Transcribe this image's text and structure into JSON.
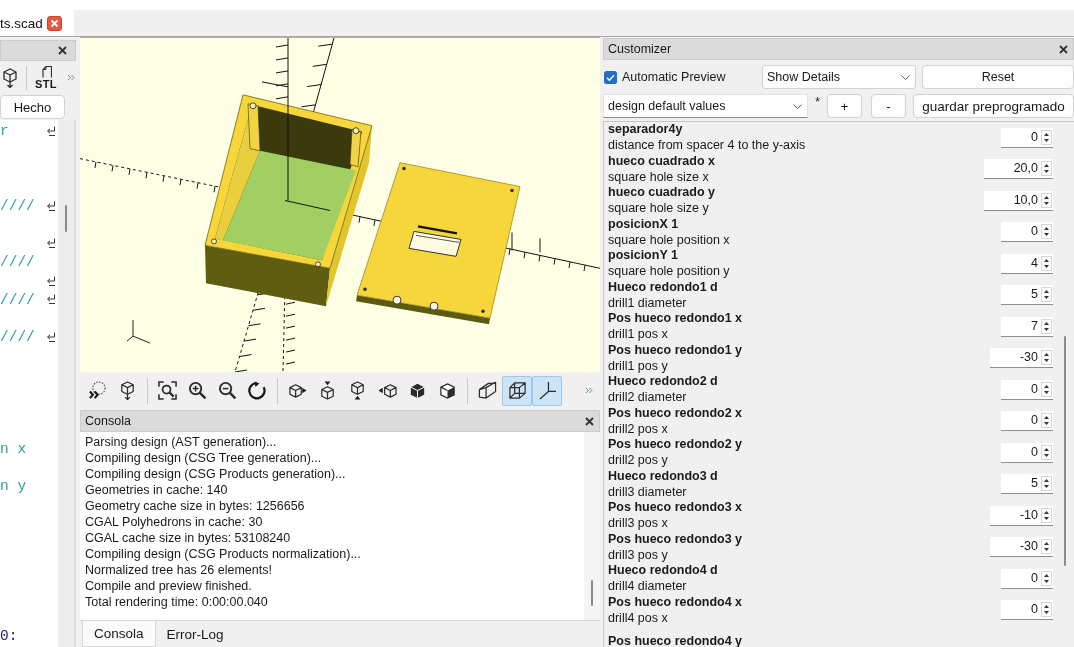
{
  "tab": {
    "label": "ts.scad"
  },
  "editor": {
    "export_label": "STL",
    "done_button": "Hecho",
    "lines": [
      {
        "kind": "comment",
        "text": "r",
        "wrapped": true
      },
      {
        "wrapped": false
      },
      {
        "wrapped": false
      },
      {
        "wrapped": false
      },
      {
        "kind": "comment",
        "text": "////",
        "wrapped": true
      },
      {
        "wrapped": false
      },
      {
        "wrapped": true
      },
      {
        "kind": "comment",
        "text": "////",
        "wrapped": false
      },
      {
        "wrapped": true
      },
      {
        "kind": "comment",
        "text": "////",
        "wrapped": true
      },
      {
        "wrapped": false
      },
      {
        "kind": "comment",
        "text": "////",
        "wrapped": true
      },
      {
        "wrapped": false
      },
      {
        "wrapped": false
      },
      {
        "wrapped": false
      },
      {
        "wrapped": false
      },
      {
        "wrapped": false
      },
      {
        "kind": "comment",
        "text": "n x",
        "wrapped": false
      },
      {
        "wrapped": false
      },
      {
        "kind": "comment",
        "text": "n y",
        "wrapped": false
      },
      {
        "wrapped": false
      },
      {
        "wrapped": false
      },
      {
        "wrapped": false
      },
      {
        "wrapped": false
      },
      {
        "wrapped": false
      },
      {
        "wrapped": false
      },
      {
        "wrapped": false
      },
      {
        "kind": "code",
        "text": "0:",
        "wrapped": false
      }
    ]
  },
  "view_toolbar": {
    "groups": [
      [
        {
          "kind": "preview",
          "on": false
        },
        {
          "kind": "render",
          "on": false
        }
      ],
      [
        {
          "kind": "view_all",
          "on": false
        },
        {
          "kind": "zoom_in",
          "on": false
        },
        {
          "kind": "zoom_out",
          "on": false
        },
        {
          "kind": "reset_view",
          "on": false
        }
      ],
      [
        {
          "kind": "view_right",
          "on": false
        },
        {
          "kind": "view_top",
          "on": false
        },
        {
          "kind": "view_bottom",
          "on": false
        },
        {
          "kind": "view_left",
          "on": false
        },
        {
          "kind": "view_front",
          "on": false
        },
        {
          "kind": "view_back",
          "on": false
        }
      ],
      [
        {
          "kind": "perspective",
          "on": false
        },
        {
          "kind": "orthogonal",
          "on": true
        },
        {
          "kind": "axes",
          "on": true
        }
      ]
    ]
  },
  "console": {
    "title": "Consola",
    "lines": [
      "Parsing design (AST generation)...",
      "Compiling design (CSG Tree generation)...",
      "Compiling design (CSG Products generation)...",
      "Geometries in cache: 140",
      "Geometry cache size in bytes: 1256656",
      "CGAL Polyhedrons in cache: 30",
      "CGAL cache size in bytes: 53108240",
      "Compiling design (CSG Products normalization)...",
      "Normalized tree has 26 elements!",
      "Compile and preview finished.",
      "Total rendering time: 0:00:00.040"
    ],
    "tabs": [
      {
        "label": "Consola",
        "selected": true
      },
      {
        "label": "Error-Log",
        "selected": false
      }
    ]
  },
  "customizer": {
    "title": "Customizer",
    "automatic_preview": {
      "label": "Automatic Preview",
      "checked": true
    },
    "details_dropdown": "Show Details",
    "reset_button": "Reset",
    "preset_dropdown": "design default values",
    "modified_mark": "*",
    "add_button": "+",
    "remove_button": "-",
    "save_button": "guardar preprogramado",
    "parameters": [
      {
        "name": "separador4y",
        "description": "distance from spacer 4 to the y-axis",
        "value": "0"
      },
      {
        "name": "hueco cuadrado x",
        "description": "square hole size x",
        "value": "20,0"
      },
      {
        "name": "hueco cuadrado y",
        "description": "square hole size y",
        "value": "10,0"
      },
      {
        "name": "posicionX 1",
        "description": "square hole position x",
        "value": "0"
      },
      {
        "name": "posicionY 1",
        "description": "square hole position y",
        "value": "4"
      },
      {
        "name": "Hueco redondo1 d",
        "description": "drill1 diameter",
        "value": "5"
      },
      {
        "name": "Pos hueco redondo1 x",
        "description": "drill1 pos x",
        "value": "7"
      },
      {
        "name": "Pos hueco redondo1 y",
        "description": "drill1 pos y",
        "value": "-30"
      },
      {
        "name": "Hueco redondo2 d",
        "description": "drill2 diameter",
        "value": "0"
      },
      {
        "name": "Pos hueco redondo2 x",
        "description": "drill2 pos x",
        "value": "0"
      },
      {
        "name": "Pos hueco redondo2 y",
        "description": "drill2 pos y",
        "value": "0"
      },
      {
        "name": "Hueco redondo3 d",
        "description": "drill3 diameter",
        "value": "5"
      },
      {
        "name": "Pos hueco redondo3 x",
        "description": "drill3 pos x",
        "value": "-10"
      },
      {
        "name": "Pos hueco redondo3 y",
        "description": "drill3 pos y",
        "value": "-30"
      },
      {
        "name": "Hueco redondo4 d",
        "description": "drill4 diameter",
        "value": "0"
      },
      {
        "name": "Pos hueco redondo4 x",
        "description": "drill4 pos x",
        "value": "0"
      },
      {
        "name": "Pos hueco redondo4 y"
      }
    ]
  }
}
